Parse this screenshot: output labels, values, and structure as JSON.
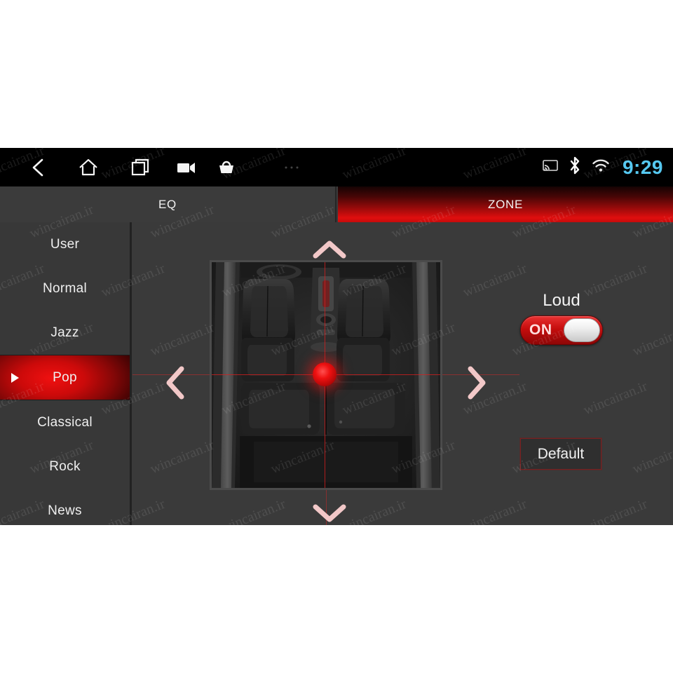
{
  "statusbar": {
    "icons": [
      {
        "name": "back-icon",
        "glyph": "back"
      },
      {
        "name": "home-icon",
        "glyph": "home"
      },
      {
        "name": "recents-icon",
        "glyph": "recents"
      },
      {
        "name": "video-recorder-icon",
        "glyph": "camcorder"
      },
      {
        "name": "apps-icon",
        "glyph": "basket"
      },
      {
        "name": "more-icon",
        "glyph": "dots"
      }
    ],
    "system_icons": [
      {
        "name": "cast-icon"
      },
      {
        "name": "bluetooth-icon"
      },
      {
        "name": "wifi-icon"
      }
    ],
    "clock": "9:29",
    "clock_color": "#55c8f0"
  },
  "tabs": [
    {
      "label": "EQ",
      "active": false
    },
    {
      "label": "ZONE",
      "active": true
    }
  ],
  "sidebar": {
    "presets": [
      {
        "label": "User",
        "selected": false
      },
      {
        "label": "Normal",
        "selected": false
      },
      {
        "label": "Jazz",
        "selected": false
      },
      {
        "label": "Pop",
        "selected": true
      },
      {
        "label": "Classical",
        "selected": false
      },
      {
        "label": "Rock",
        "selected": false
      },
      {
        "label": "News",
        "selected": false
      }
    ]
  },
  "zone": {
    "pad_name": "sound-stage-pad",
    "position_marker": "listening-position-dot",
    "arrows": {
      "up": "⌃",
      "down": "⌄",
      "left": "‹",
      "right": "›"
    }
  },
  "controls": {
    "loud_label": "Loud",
    "loud_state": "ON",
    "loud_enabled": true,
    "default_label": "Default"
  },
  "colors": {
    "accent_red": "#e00e0e",
    "panel_bg": "#3a3a3a",
    "statusbar_bg": "#000000",
    "text": "#f2f2f2"
  },
  "watermark": {
    "text": "wincairan.ir"
  }
}
